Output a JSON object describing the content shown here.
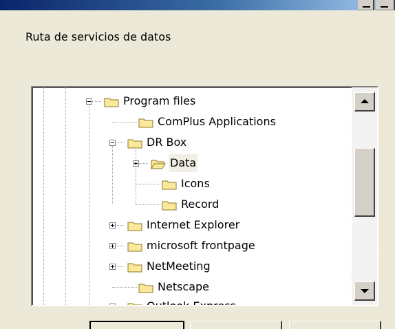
{
  "dialog": {
    "label": "Ruta de servicios de datos"
  },
  "tree": {
    "items": [
      {
        "label": "Program files",
        "expander": "minus"
      },
      {
        "label": "ComPlus Applications",
        "expander": "none"
      },
      {
        "label": "DR Box",
        "expander": "minus"
      },
      {
        "label": "Data",
        "expander": "plus",
        "selected": true,
        "folder": "open"
      },
      {
        "label": "Icons",
        "expander": "none"
      },
      {
        "label": "Record",
        "expander": "none"
      },
      {
        "label": "Internet Explorer",
        "expander": "plus"
      },
      {
        "label": "microsoft frontpage",
        "expander": "plus"
      },
      {
        "label": "NetMeeting",
        "expander": "plus"
      },
      {
        "label": "Netscape",
        "expander": "none"
      },
      {
        "label": "Outlook Express",
        "expander": "plus"
      }
    ]
  },
  "colors": {
    "folder_fill": "#fbe89a",
    "folder_stroke": "#8b7a2a",
    "selected_bg": "#f2f0e6"
  }
}
